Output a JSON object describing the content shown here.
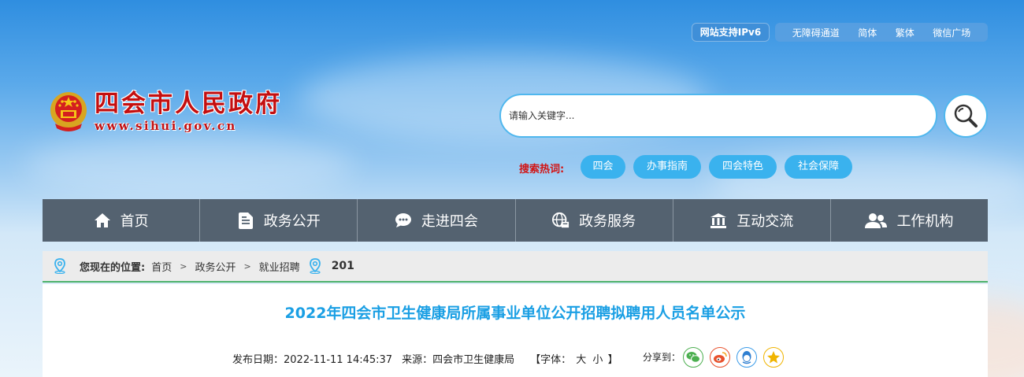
{
  "utility": {
    "ipv6": "网站支持IPv6",
    "links": [
      "无障碍通道",
      "简体",
      "繁体",
      "微信广场"
    ]
  },
  "logo": {
    "title": "四会市人民政府",
    "url": "www.sihui.gov.cn"
  },
  "search": {
    "placeholder": "请输入关键字...",
    "hot_label": "搜索热词:",
    "hot_tags": [
      "四会",
      "办事指南",
      "四会特色",
      "社会保障"
    ]
  },
  "nav": {
    "items": [
      {
        "label": "首页",
        "icon": "home-icon"
      },
      {
        "label": "政务公开",
        "icon": "document-icon"
      },
      {
        "label": "走进四会",
        "icon": "chat-icon"
      },
      {
        "label": "政务服务",
        "icon": "globe-icon"
      },
      {
        "label": "互动交流",
        "icon": "building-icon"
      },
      {
        "label": "工作机构",
        "icon": "users-icon"
      }
    ]
  },
  "breadcrumb": {
    "label": "您现在的位置:",
    "items": [
      "首页",
      "政务公开",
      "就业招聘"
    ],
    "count": "201"
  },
  "article": {
    "title": "2022年四会市卫生健康局所属事业单位公开招聘拟聘用人员名单公示",
    "date": "发布日期：2022-11-11 14:45:37",
    "source": "来源：四会市卫生健康局",
    "font_label": "【字体：",
    "font_large": "大",
    "font_small": "小",
    "font_end": "】",
    "share_label": "分享到：",
    "share_icons": [
      "wechat-icon",
      "weibo-icon",
      "qq-icon",
      "qzone-icon"
    ]
  },
  "colors": {
    "brand_red": "#c40f10",
    "accent_blue": "#3ab2ee",
    "title_blue": "#1a9fe4",
    "nav_bg": "#546270",
    "breadcrumb_line": "#4eb26b"
  }
}
